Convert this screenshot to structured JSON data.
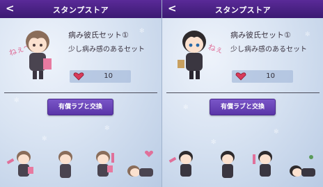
{
  "panels": [
    {
      "header_title": "スタンプストア",
      "back_label": "<",
      "set_name": "病み彼氏セット①",
      "set_description": "少し病み感のあるセット",
      "price": "10",
      "exchange_label": "有償ラブと交換",
      "avatar_text": "ねぇ〜",
      "hair_color": "#8a6d5a"
    },
    {
      "header_title": "スタンプストア",
      "back_label": "<",
      "set_name": "病み彼氏セット①",
      "set_description": "少し病み感のあるセット",
      "price": "10",
      "exchange_label": "有償ラブと交換",
      "avatar_text": "ねぇ〜",
      "hair_color": "#2e2a2c"
    }
  ],
  "colors": {
    "header": "#4a2385",
    "button": "#6a45b8",
    "accent_pink": "#e0709a"
  }
}
